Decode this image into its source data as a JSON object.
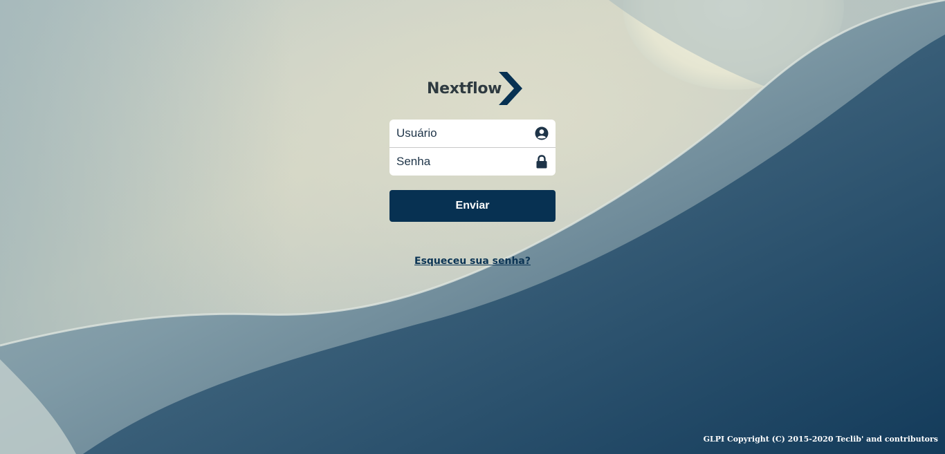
{
  "brand": {
    "name": "Nextflow",
    "color": "#2e3a40",
    "accent": "#073152"
  },
  "login": {
    "username_placeholder": "Usuário",
    "password_placeholder": "Senha",
    "username_icon": "user-circle-icon",
    "password_icon": "lock-icon",
    "submit_label": "Enviar",
    "forgot_label": "Esqueceu sua senha?"
  },
  "footer": {
    "copyright": "GLPI Copyright (C) 2015-2020 Teclib' and contributors"
  }
}
